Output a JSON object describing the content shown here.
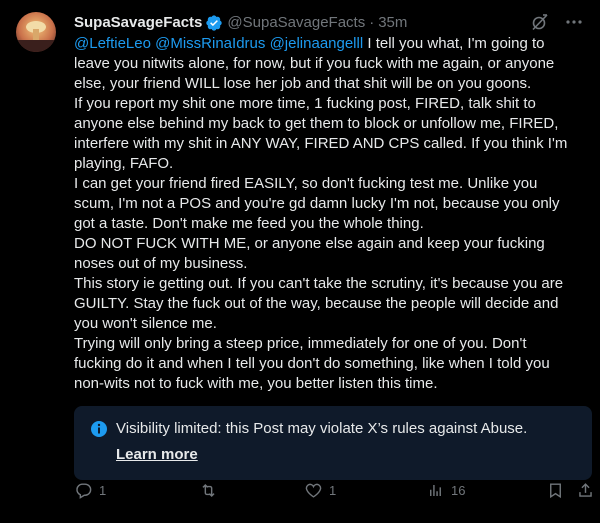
{
  "tweet": {
    "display_name": "SupaSavageFacts",
    "handle": "@SupaSavageFacts",
    "separator": "·",
    "time": "35m",
    "mentions": [
      "@LeftieLeo",
      "@MissRinaIdrus",
      "@jelinaangelll"
    ],
    "body_first": " I tell you what, I'm going to leave you nitwits alone, for now, but if you fuck with me again, or anyone else, your friend WILL lose her job and that shit will be on you goons.\nIf you report my shit one more time, 1 fucking post, FIRED, talk shit to anyone else behind my back to get them to block or unfollow me, FIRED, interfere with my shit in ANY WAY, FIRED AND CPS called. If you think I'm playing, FAFO.\nI can get your friend fired EASILY, so don't fucking test me. Unlike you scum, I'm not a POS and you're gd damn lucky I'm not, because you only got a taste. Don't make me feed you the whole thing.\nDO NOT FUCK WITH ME, or anyone else again and keep your fucking noses out of my business.\nThis story ie getting out. If you can't take the scrutiny, it's because you are GUILTY. Stay the fuck out of the way, because the people will decide and you won't silence me.\nTrying will only bring a steep price, immediately for one of you. Don't fucking do it and when I tell you don't do something, like when I told you non-wits not to fuck with me, you better listen this time."
  },
  "notice": {
    "text": "Visibility limited: this Post may violate X’s rules against Abuse.",
    "link": "Learn more"
  },
  "actions": {
    "replies": "1",
    "retweets": "",
    "likes": "1",
    "views": "16"
  },
  "colors": {
    "background": "#000000",
    "text": "#e7e9ea",
    "secondary": "#71767b",
    "accent": "#1d9bf0",
    "notice_bg": "#0f1a2a"
  },
  "icons": [
    "verified-badge-icon",
    "grok-icon",
    "more-icon",
    "info-icon",
    "reply-icon",
    "retweet-icon",
    "like-icon",
    "views-icon",
    "bookmark-icon",
    "share-icon"
  ]
}
